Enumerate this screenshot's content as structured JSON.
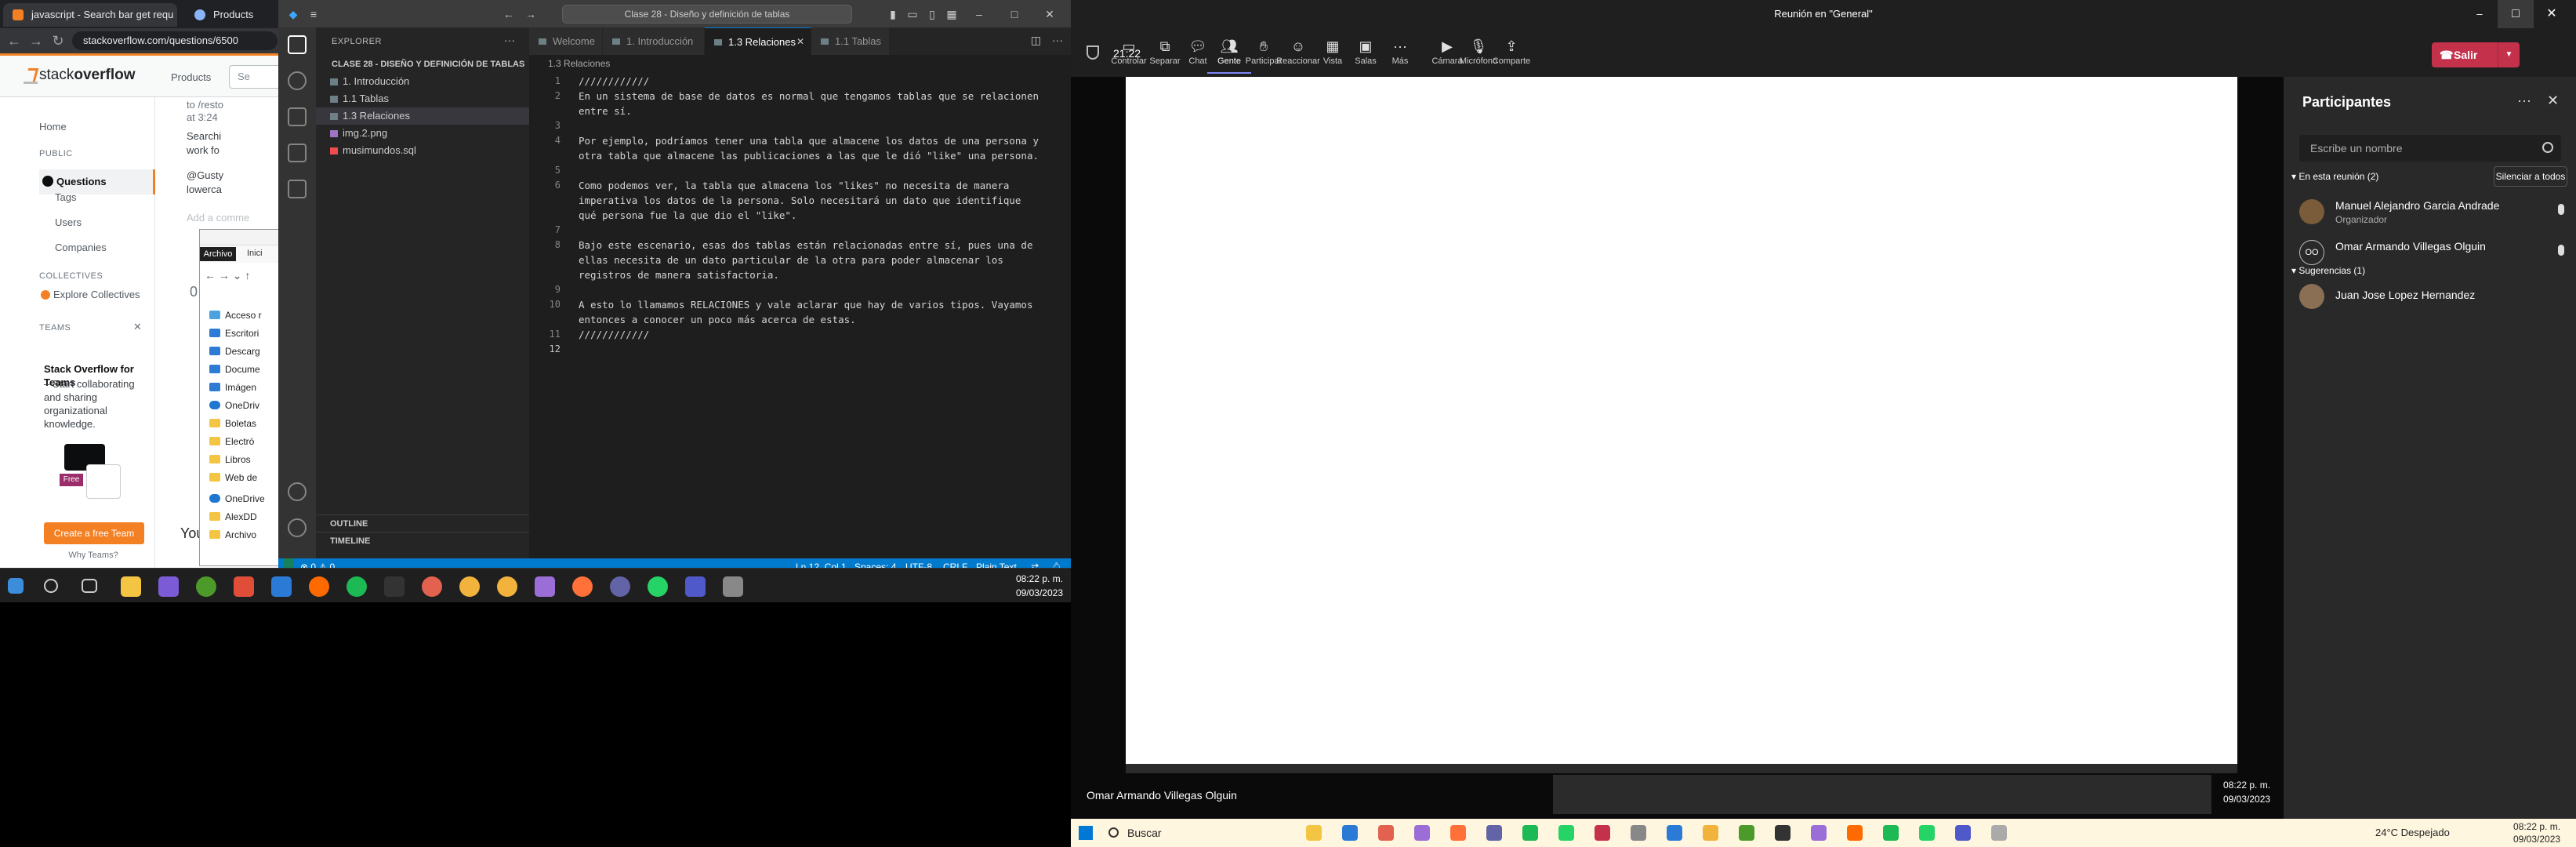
{
  "browser": {
    "tabs": [
      {
        "label": "javascript - Search bar get requ"
      },
      {
        "label": "Products"
      }
    ],
    "url": "stackoverflow.com/questions/6500",
    "logo_plain": "stack",
    "logo_bold": "overflow",
    "products": "Products",
    "search_placeholder": "Se",
    "sidebar": {
      "home": "Home",
      "public": "PUBLIC",
      "questions": "Questions",
      "tags": "Tags",
      "users": "Users",
      "companies": "Companies",
      "collectives": "COLLECTIVES",
      "explore_collectives": "Explore Collectives",
      "teams": "TEAMS",
      "teams_title": "Stack Overflow for Teams",
      "teams_body": "– Start collaborating and sharing organizational knowledge.",
      "free_badge": "Free",
      "create_team": "Create a free Team",
      "why_teams": "Why Teams?"
    },
    "main_fragments": [
      "to /resto",
      "at 3:24",
      "Searchi",
      "work fo",
      "@Gusty",
      "lowerca",
      "Add a comme",
      "0",
      "You"
    ]
  },
  "file_explorer": {
    "ribbon_tabs": [
      "Archivo",
      "Inici"
    ],
    "items": [
      {
        "label": "Acceso r",
        "type": "star"
      },
      {
        "label": "Escritori",
        "type": "blue"
      },
      {
        "label": "Descarg",
        "type": "blue"
      },
      {
        "label": "Docume",
        "type": "blue"
      },
      {
        "label": "Imágen",
        "type": "blue"
      },
      {
        "label": "OneDriv",
        "type": "cloud"
      },
      {
        "label": "Boletas",
        "type": "folder"
      },
      {
        "label": "Electró",
        "type": "folder"
      },
      {
        "label": "Libros",
        "type": "folder"
      },
      {
        "label": "Web de",
        "type": "folder"
      },
      {
        "label": "OneDrive",
        "type": "cloud"
      },
      {
        "label": "AlexDD",
        "type": "folder"
      },
      {
        "label": "Archivo",
        "type": "folder"
      }
    ]
  },
  "vscode": {
    "command_center": "Clase 28 - Diseño y definición de tablas",
    "explorer_header": "EXPLORER",
    "folder": "CLASE 28 - DISEÑO Y DEFINICIÓN DE TABLAS",
    "files": [
      {
        "label": "1. Introducción",
        "kind": "md"
      },
      {
        "label": "1.1 Tablas",
        "kind": "md"
      },
      {
        "label": "1.3 Relaciones",
        "kind": "md",
        "active": true
      },
      {
        "label": "img.2.png",
        "kind": "img"
      },
      {
        "label": "musimundos.sql",
        "kind": "db"
      }
    ],
    "outline": "OUTLINE",
    "timeline": "TIMELINE",
    "tabs": [
      "Welcome",
      "1. Introducción",
      "1.3 Relaciones",
      "1.1 Tablas"
    ],
    "active_tab": "1.3 Relaciones",
    "breadcrumb": "1.3 Relaciones",
    "lines": [
      {
        "n": "1",
        "text": "////////////"
      },
      {
        "n": "2",
        "text": "En un sistema de base de datos es normal que tengamos tablas que se relacionen"
      },
      {
        "n": "",
        "text": "entre sí."
      },
      {
        "n": "3",
        "text": ""
      },
      {
        "n": "4",
        "text": "Por ejemplo, podríamos tener una tabla que almacene los datos de una persona y"
      },
      {
        "n": "",
        "text": "otra tabla que almacene las publicaciones a las que le dió \"like\" una persona."
      },
      {
        "n": "5",
        "text": ""
      },
      {
        "n": "6",
        "text": "Como podemos ver, la tabla que almacena los \"likes\" no necesita de manera"
      },
      {
        "n": "",
        "text": "imperativa los datos de la persona. Solo necesitará un dato que identifique"
      },
      {
        "n": "",
        "text": "qué persona fue la que dio el \"like\"."
      },
      {
        "n": "7",
        "text": ""
      },
      {
        "n": "8",
        "text": "Bajo este escenario, esas dos tablas están relacionadas entre sí, pues una de"
      },
      {
        "n": "",
        "text": "ellas necesita de un dato particular de la otra para poder almacenar los"
      },
      {
        "n": "",
        "text": "registros de manera satisfactoria."
      },
      {
        "n": "9",
        "text": ""
      },
      {
        "n": "10",
        "text": "A esto lo llamamos RELACIONES y vale aclarar que hay de varios tipos. Vayamos"
      },
      {
        "n": "",
        "text": "entonces a conocer un poco más acerca de estas."
      },
      {
        "n": "11",
        "text": "////////////"
      },
      {
        "n": "12",
        "text": ""
      }
    ],
    "status": {
      "problems": "⊗ 0 ⚠ 0",
      "position": "Ln 12, Col 1",
      "spaces": "Spaces: 4",
      "encoding": "UTF-8",
      "eol": "CRLF",
      "language": "Plain Text"
    }
  },
  "left_taskbar": {
    "time": "08:22 p. m.",
    "date": "09/03/2023"
  },
  "teams": {
    "window_title": "Reunión en \"General\"",
    "timer": "21:22",
    "toolbar": [
      {
        "label": "Controlar",
        "icon": "control-icon"
      },
      {
        "label": "Separar",
        "icon": "pop-out-icon"
      },
      {
        "label": "Chat",
        "icon": "chat-icon"
      },
      {
        "label": "Gente",
        "icon": "people-icon",
        "selected": true
      },
      {
        "label": "Participar",
        "icon": "raise-hand-icon"
      },
      {
        "label": "Reaccionar",
        "icon": "reaction-icon"
      },
      {
        "label": "Vista",
        "icon": "view-icon"
      },
      {
        "label": "Salas",
        "icon": "rooms-icon"
      },
      {
        "label": "Más",
        "icon": "more-icon"
      },
      {
        "label": "Cámara",
        "icon": "camera-icon"
      },
      {
        "label": "Micrófono",
        "icon": "microphone-icon"
      },
      {
        "label": "Comparte",
        "icon": "share-icon"
      }
    ],
    "leave": "Salir",
    "presenter": "Omar Armando Villegas Olguin",
    "screen_time": "08:22 p. m.",
    "screen_date": "09/03/2023",
    "panel": {
      "title": "Participantes",
      "invite_placeholder": "Escribe un nombre",
      "in_meeting": "En esta reunión (2)",
      "mute_all": "Silenciar a todos",
      "participants": [
        {
          "name": "Manuel Alejandro Garcia Andrade",
          "role": "Organizador",
          "initials": ""
        },
        {
          "name": "Omar Armando Villegas Olguin",
          "role": "",
          "initials": "OO"
        }
      ],
      "suggestions": "Sugerencias (1)",
      "suggested": [
        {
          "name": "Juan Jose Lopez Hernandez"
        }
      ]
    },
    "taskbar": {
      "search": "Buscar",
      "weather": "24°C Despejado",
      "time": "08:22 p. m.",
      "date": "09/03/2023"
    }
  },
  "colors": {
    "so_orange": "#f48024",
    "vs_blue": "#007acc",
    "teams_leave": "#c4314b",
    "teams_accent": "#7f85f5"
  }
}
